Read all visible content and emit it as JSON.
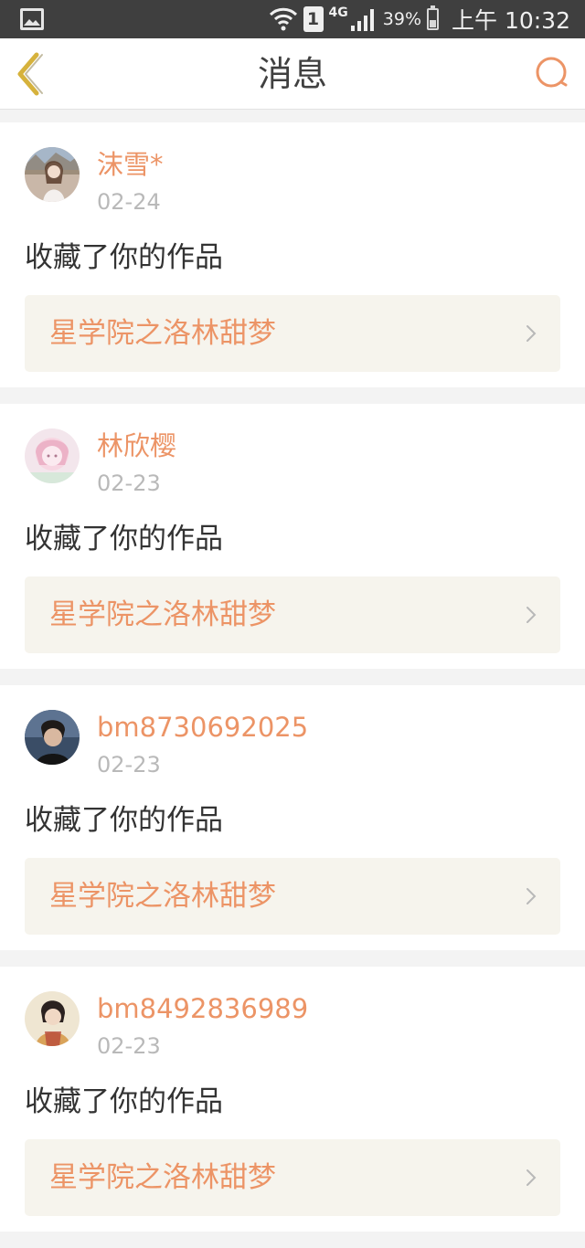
{
  "status_bar": {
    "sim": "1",
    "network": "4G",
    "battery": "39%",
    "battery_level": 0.39,
    "time": "上午 10:32",
    "icons": [
      "image-icon",
      "wifi-icon",
      "sim-icon",
      "signal-icon",
      "battery-icon"
    ]
  },
  "header": {
    "title": "消息",
    "back_icon": "chevron-left-icon",
    "search_icon": "search-icon"
  },
  "colors": {
    "accent": "#ec9466",
    "back_icon": "#d6b23c",
    "card_link_bg": "#f6f4ed",
    "page_bg": "#f3f3f3"
  },
  "messages": [
    {
      "username": "沫雪*",
      "date": "02-24",
      "action": "收藏了你的作品",
      "work_title": "星学院之洛林甜梦"
    },
    {
      "username": "林欣樱",
      "date": "02-23",
      "action": "收藏了你的作品",
      "work_title": "星学院之洛林甜梦"
    },
    {
      "username": "bm8730692025",
      "date": "02-23",
      "action": "收藏了你的作品",
      "work_title": "星学院之洛林甜梦"
    },
    {
      "username": "bm8492836989",
      "date": "02-23",
      "action": "收藏了你的作品",
      "work_title": "星学院之洛林甜梦"
    }
  ]
}
